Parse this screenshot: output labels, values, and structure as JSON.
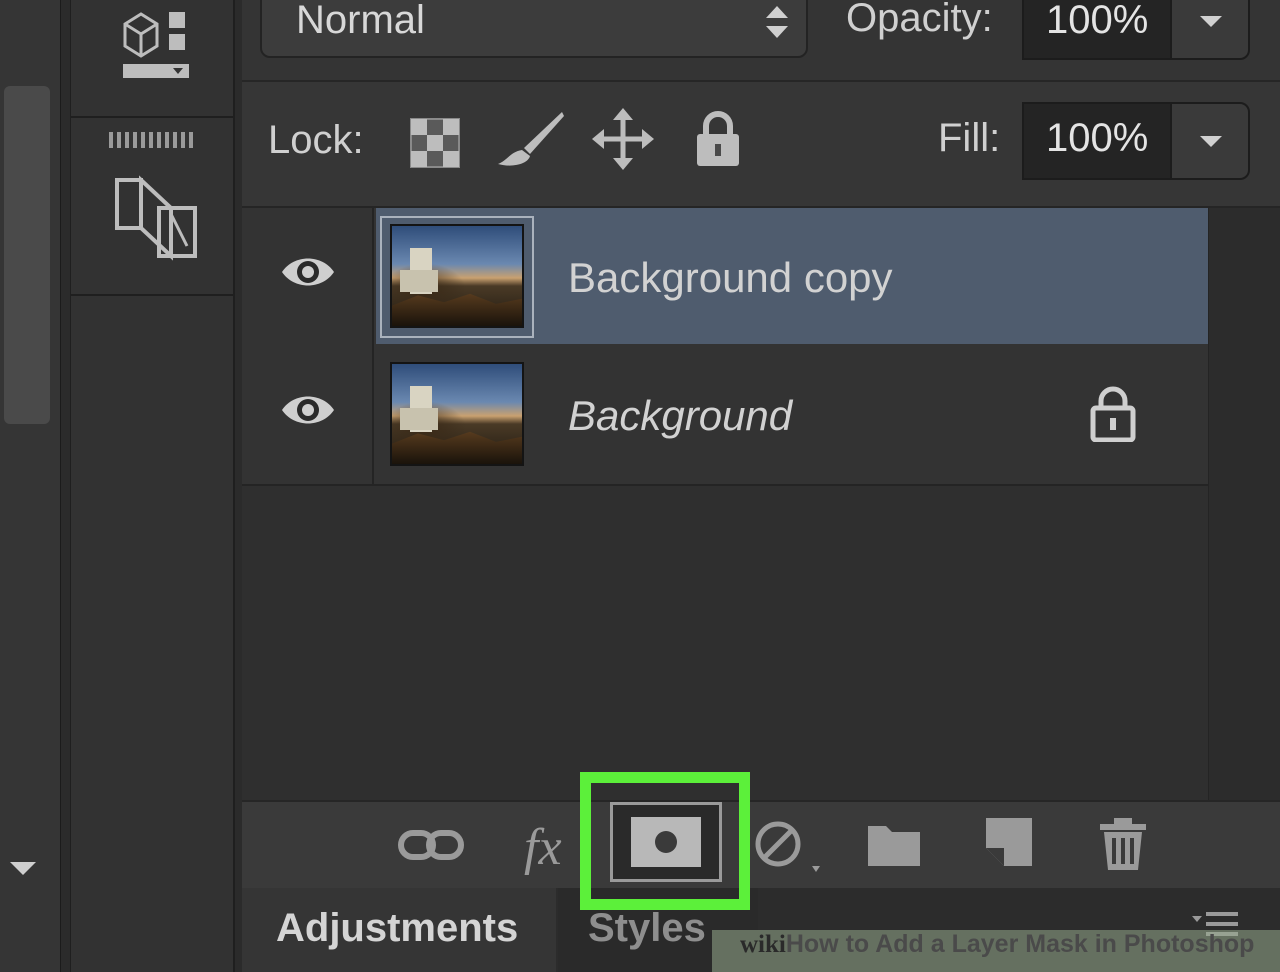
{
  "blend_mode": {
    "selected": "Normal"
  },
  "opacity": {
    "label": "Opacity:",
    "value": "100%"
  },
  "lock": {
    "label": "Lock:"
  },
  "fill": {
    "label": "Fill:",
    "value": "100%"
  },
  "layers": [
    {
      "name": "Background copy",
      "selected": true,
      "locked": false,
      "italic": false
    },
    {
      "name": "Background",
      "selected": false,
      "locked": true,
      "italic": true
    }
  ],
  "tabs": [
    {
      "label": "Adjustments",
      "active": true
    },
    {
      "label": "Styles",
      "active": false
    }
  ],
  "watermark": {
    "brand": "wiki",
    "title": "How to Add a Layer Mask in Photoshop"
  },
  "colors": {
    "highlight": "#5cf03a",
    "selected_row": "#4f5c6e",
    "panel": "#333333"
  }
}
